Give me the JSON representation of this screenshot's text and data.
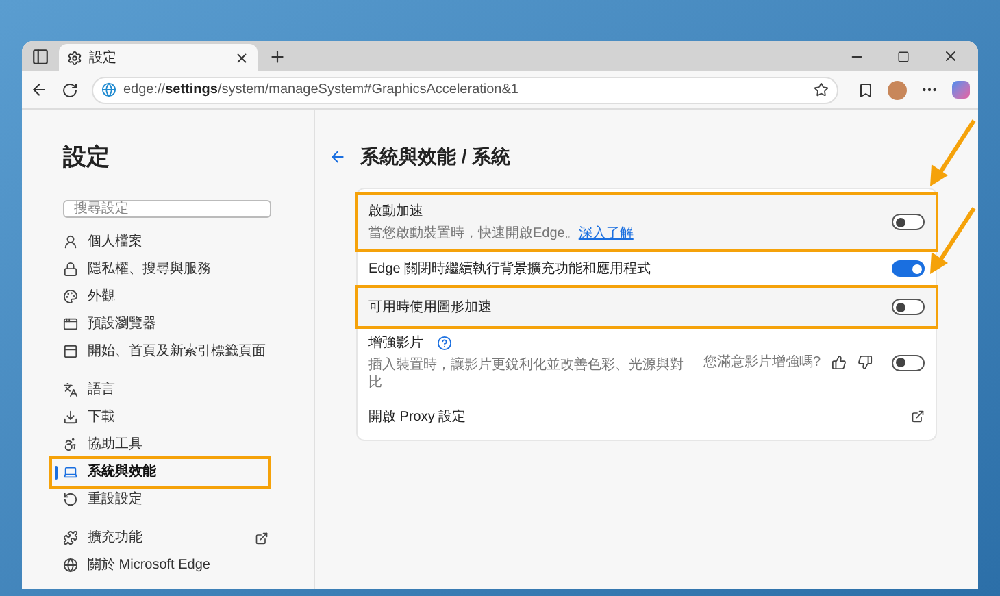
{
  "window": {
    "tab_title": "設定",
    "url_host": "edge://",
    "url_bold": "settings",
    "url_rest": "/system/manageSystem#GraphicsAcceleration&1"
  },
  "sidebar": {
    "title": "設定",
    "search_placeholder": "搜尋設定",
    "groups": [
      [
        {
          "label": "個人檔案",
          "selected": false,
          "highlighted": false,
          "external": false
        },
        {
          "label": "隱私權、搜尋與服務",
          "selected": false,
          "highlighted": false,
          "external": false
        },
        {
          "label": "外觀",
          "selected": false,
          "highlighted": false,
          "external": false
        },
        {
          "label": "預設瀏覽器",
          "selected": false,
          "highlighted": false,
          "external": false
        },
        {
          "label": "開始、首頁及新索引標籤頁面",
          "selected": false,
          "highlighted": false,
          "external": false
        }
      ],
      [
        {
          "label": "語言",
          "selected": false,
          "highlighted": false,
          "external": false
        },
        {
          "label": "下載",
          "selected": false,
          "highlighted": false,
          "external": false
        },
        {
          "label": "協助工具",
          "selected": false,
          "highlighted": false,
          "external": false
        },
        {
          "label": "系統與效能",
          "selected": true,
          "highlighted": true,
          "external": false
        },
        {
          "label": "重設設定",
          "selected": false,
          "highlighted": false,
          "external": false
        }
      ],
      [
        {
          "label": "擴充功能",
          "selected": false,
          "highlighted": false,
          "external": true
        },
        {
          "label": "關於 Microsoft Edge",
          "selected": false,
          "highlighted": false,
          "external": false
        }
      ]
    ]
  },
  "main": {
    "title": "系統與效能 / 系統",
    "settings": [
      {
        "kind": "toggle",
        "label": "啟動加速",
        "description": "當您啟動裝置時，快速開啟Edge。",
        "link": "深入了解",
        "on": false,
        "highlighted": true
      },
      {
        "kind": "toggle",
        "label": "Edge 關閉時繼續執行背景擴充功能和應用程式",
        "on": true,
        "highlighted": false
      },
      {
        "kind": "toggle",
        "label": "可用時使用圖形加速",
        "on": false,
        "highlighted": true
      },
      {
        "kind": "feedback",
        "label": "增強影片",
        "description": "插入裝置時，讓影片更銳利化並改善色彩、光源與對比",
        "question": "您滿意影片增強嗎?",
        "on": false,
        "highlighted": false
      },
      {
        "kind": "link",
        "label": "開啟 Proxy 設定",
        "highlighted": false
      }
    ]
  }
}
